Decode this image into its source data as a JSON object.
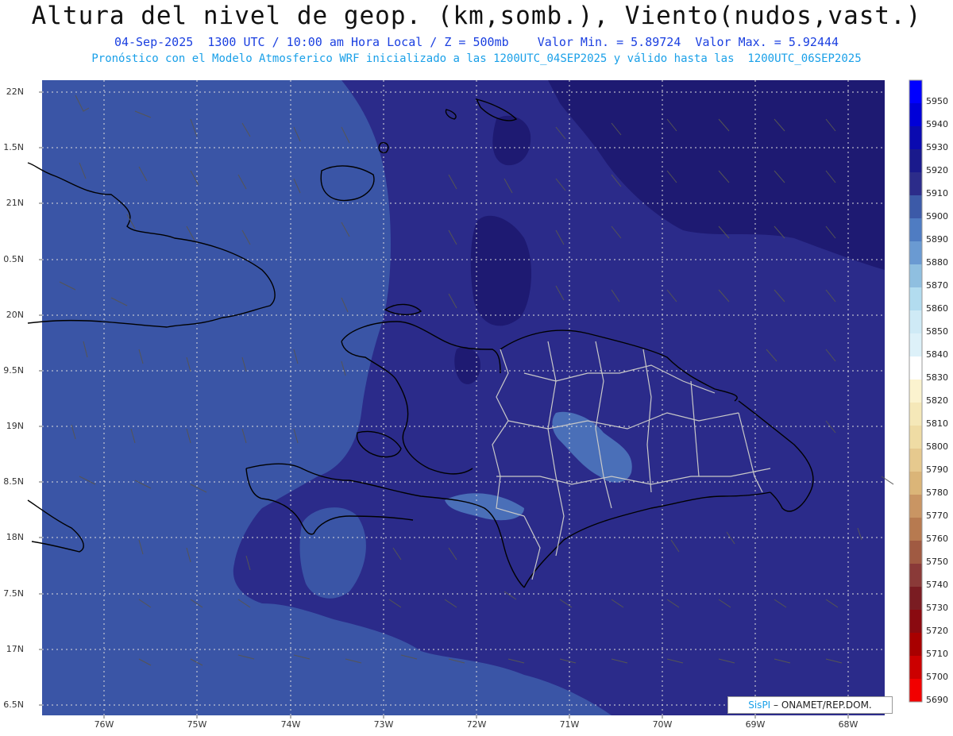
{
  "title": "Altura del nivel de geop. (km,somb.), Viento(nudos,vast.)",
  "subtitle_line1": "04-Sep-2025  1300 UTC / 10:00 am Hora Local / Z = 500mb    Valor Min. = 5.89724  Valor Max. = 5.92444",
  "subtitle_line2": "Pronóstico con el Modelo Atmosferico WRF inicializado a las 1200UTC_04SEP2025 y válido hasta las  1200UTC_06SEP2025",
  "lat_labels": [
    "22N",
    "1.5N",
    "21N",
    "0.5N",
    "20N",
    "9.5N",
    "19N",
    "8.5N",
    "18N",
    "7.5N",
    "17N",
    "6.5N"
  ],
  "lon_labels": [
    "76W",
    "75W",
    "74W",
    "73W",
    "72W",
    "71W",
    "70W",
    "69W",
    "68W"
  ],
  "colorbar": {
    "labels": [
      "5950",
      "5940",
      "5930",
      "5920",
      "5910",
      "5900",
      "5890",
      "5880",
      "5870",
      "5860",
      "5850",
      "5840",
      "5830",
      "5820",
      "5810",
      "5800",
      "5790",
      "5780",
      "5770",
      "5760",
      "5750",
      "5740",
      "5730",
      "5720",
      "5710",
      "5700",
      "5690"
    ],
    "colors": [
      "#0000ff",
      "#0000d8",
      "#0a0ab0",
      "#1a1a8c",
      "#2c2c8a",
      "#3c5aa8",
      "#4f7cc2",
      "#6a9ad2",
      "#8fbfe0",
      "#b2dcef",
      "#cfeaf6",
      "#ddf1f9",
      "#ffffff",
      "#fbf3cf",
      "#f5e8b8",
      "#efdca4",
      "#e6c98e",
      "#dbb578",
      "#c99563",
      "#b77a50",
      "#a05a42",
      "#8a3a38",
      "#7a1c22",
      "#8a0a10",
      "#a80000",
      "#cc0000",
      "#f20000"
    ]
  },
  "colors": {
    "field_base": "#3a55a6",
    "field_mid": "#2b2b8a",
    "field_high": "#1e1a72",
    "field_low_patch": "#4a6fb8",
    "coast": "#000000",
    "provinces": "#c8c8c8",
    "wind_barb": "#555555",
    "grid": "#dcdcdc"
  },
  "credit": {
    "brand": "SisPI",
    "text": " – ONAMET/REP.DOM."
  },
  "map_data": {
    "field": "geopotential height 500mb",
    "min_km": 5.89724,
    "max_km": 5.92444,
    "lat_range": [
      16.45,
      22.1
    ],
    "lon_range": [
      -76.65,
      -67.6
    ]
  }
}
